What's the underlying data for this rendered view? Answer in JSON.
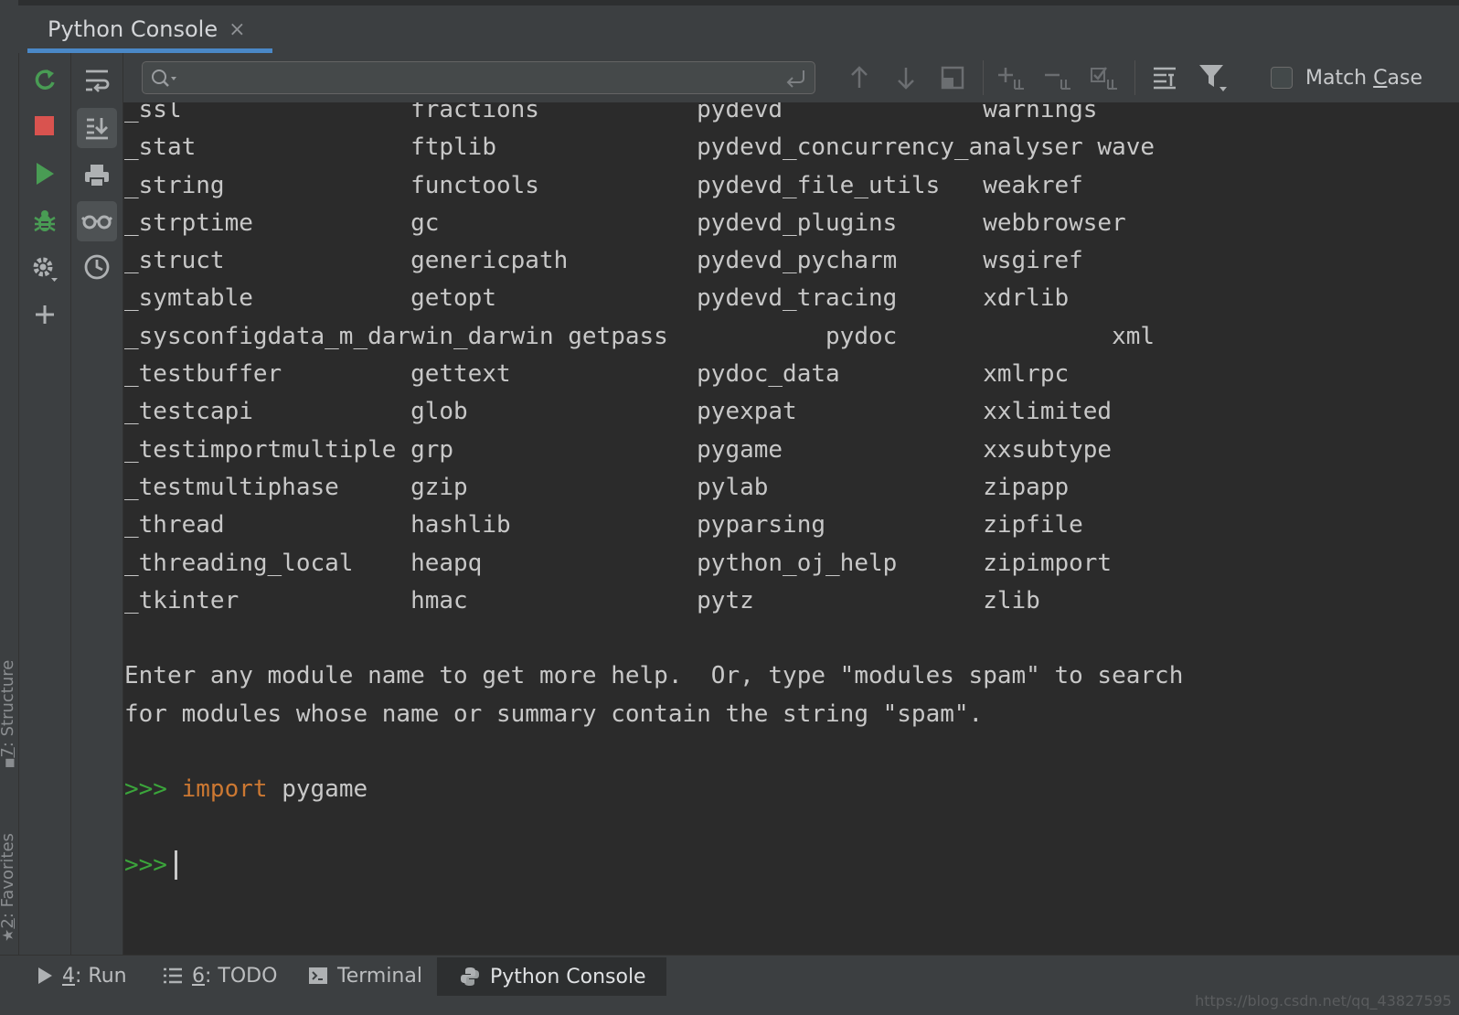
{
  "header": {
    "tab_title": "Python Console",
    "close_glyph": "×"
  },
  "left_strip": {
    "structure_label": {
      "num": "7",
      "rest": ": Structure"
    },
    "favorites_label": {
      "num": "2",
      "rest": ": Favorites"
    }
  },
  "toolbar": {
    "col1": [
      "rerun-icon",
      "stop-icon",
      "execute-icon",
      "debug-icon",
      "settings-icon",
      "add-icon"
    ],
    "col2": [
      "soft-wrap-icon",
      "scroll-to-end-icon",
      "print-icon",
      "show-variables-icon",
      "history-icon"
    ]
  },
  "find": {
    "placeholder": "",
    "value": "",
    "match_case": {
      "pre": "Match ",
      "mnemonic": "C",
      "post": "ase"
    }
  },
  "console": {
    "lines": [
      "_ssl                fractions           pydevd              warnings",
      "_stat               ftplib              pydevd_concurrency_analyser wave",
      "_string             functools           pydevd_file_utils   weakref",
      "_strptime           gc                  pydevd_plugins      webbrowser",
      "_struct             genericpath         pydevd_pycharm      wsgiref",
      "_symtable           getopt              pydevd_tracing      xdrlib",
      "_sysconfigdata_m_darwin_darwin getpass           pydoc               xml",
      "_testbuffer         gettext             pydoc_data          xmlrpc",
      "_testcapi           glob                pyexpat             xxlimited",
      "_testimportmultiple grp                 pygame              xxsubtype",
      "_testmultiphase     gzip                pylab               zipapp",
      "_thread             hashlib             pyparsing           zipfile",
      "_threading_local    heapq               python_oj_help      zipimport",
      "_tkinter            hmac                pytz                zlib",
      "",
      "Enter any module name to get more help.  Or, type \"modules spam\" to search",
      "for modules whose name or summary contain the string \"spam\".",
      ""
    ],
    "prompt": ">>>",
    "keyword": "import",
    "command_arg": "pygame"
  },
  "bottom_tabs": {
    "run": {
      "num": "4",
      "rest": ": Run"
    },
    "todo": {
      "num": "6",
      "rest": ": TODO"
    },
    "terminal": "Terminal",
    "python_console": "Python Console"
  },
  "watermark": "https://blog.csdn.net/qq_43827595",
  "colors": {
    "background": "#2b2b2b",
    "panel": "#3c3f41",
    "prompt_green": "#3ba53b",
    "keyword_orange": "#cc7832",
    "tab_accent": "#4a88c7"
  }
}
